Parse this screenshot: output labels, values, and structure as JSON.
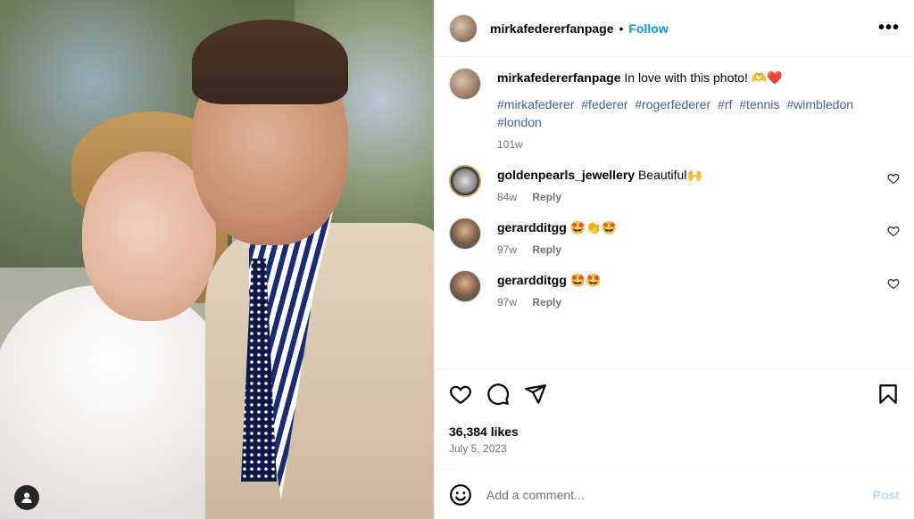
{
  "post": {
    "author": "mirkafedererfanpage",
    "follow_label": "Follow",
    "separator": "•",
    "more_label": "•••"
  },
  "caption": {
    "username": "mirkafedererfanpage",
    "text": "In love with this photo! 🫶❤️",
    "hashtags": [
      "#mirkafederer",
      "#federer",
      "#rogerfederer",
      "#rf",
      "#tennis",
      "#wimbledon",
      "#london"
    ],
    "age": "101w"
  },
  "comments": [
    {
      "username": "goldenpearls_jewellery",
      "text": "Beautiful🙌",
      "age": "84w",
      "reply_label": "Reply"
    },
    {
      "username": "gerardditgg",
      "text": "🤩👏🤩",
      "age": "97w",
      "reply_label": "Reply"
    },
    {
      "username": "gerardditgg",
      "text": "🤩🤩",
      "age": "97w",
      "reply_label": "Reply"
    }
  ],
  "stats": {
    "likes": "36,384 likes",
    "date": "July 5, 2023"
  },
  "composer": {
    "placeholder": "Add a comment...",
    "post_label": "Post"
  },
  "colors": {
    "accent": "#0095f6",
    "hashtag": "#4460a0",
    "muted": "#737373",
    "post_disabled": "#b2dffc"
  }
}
